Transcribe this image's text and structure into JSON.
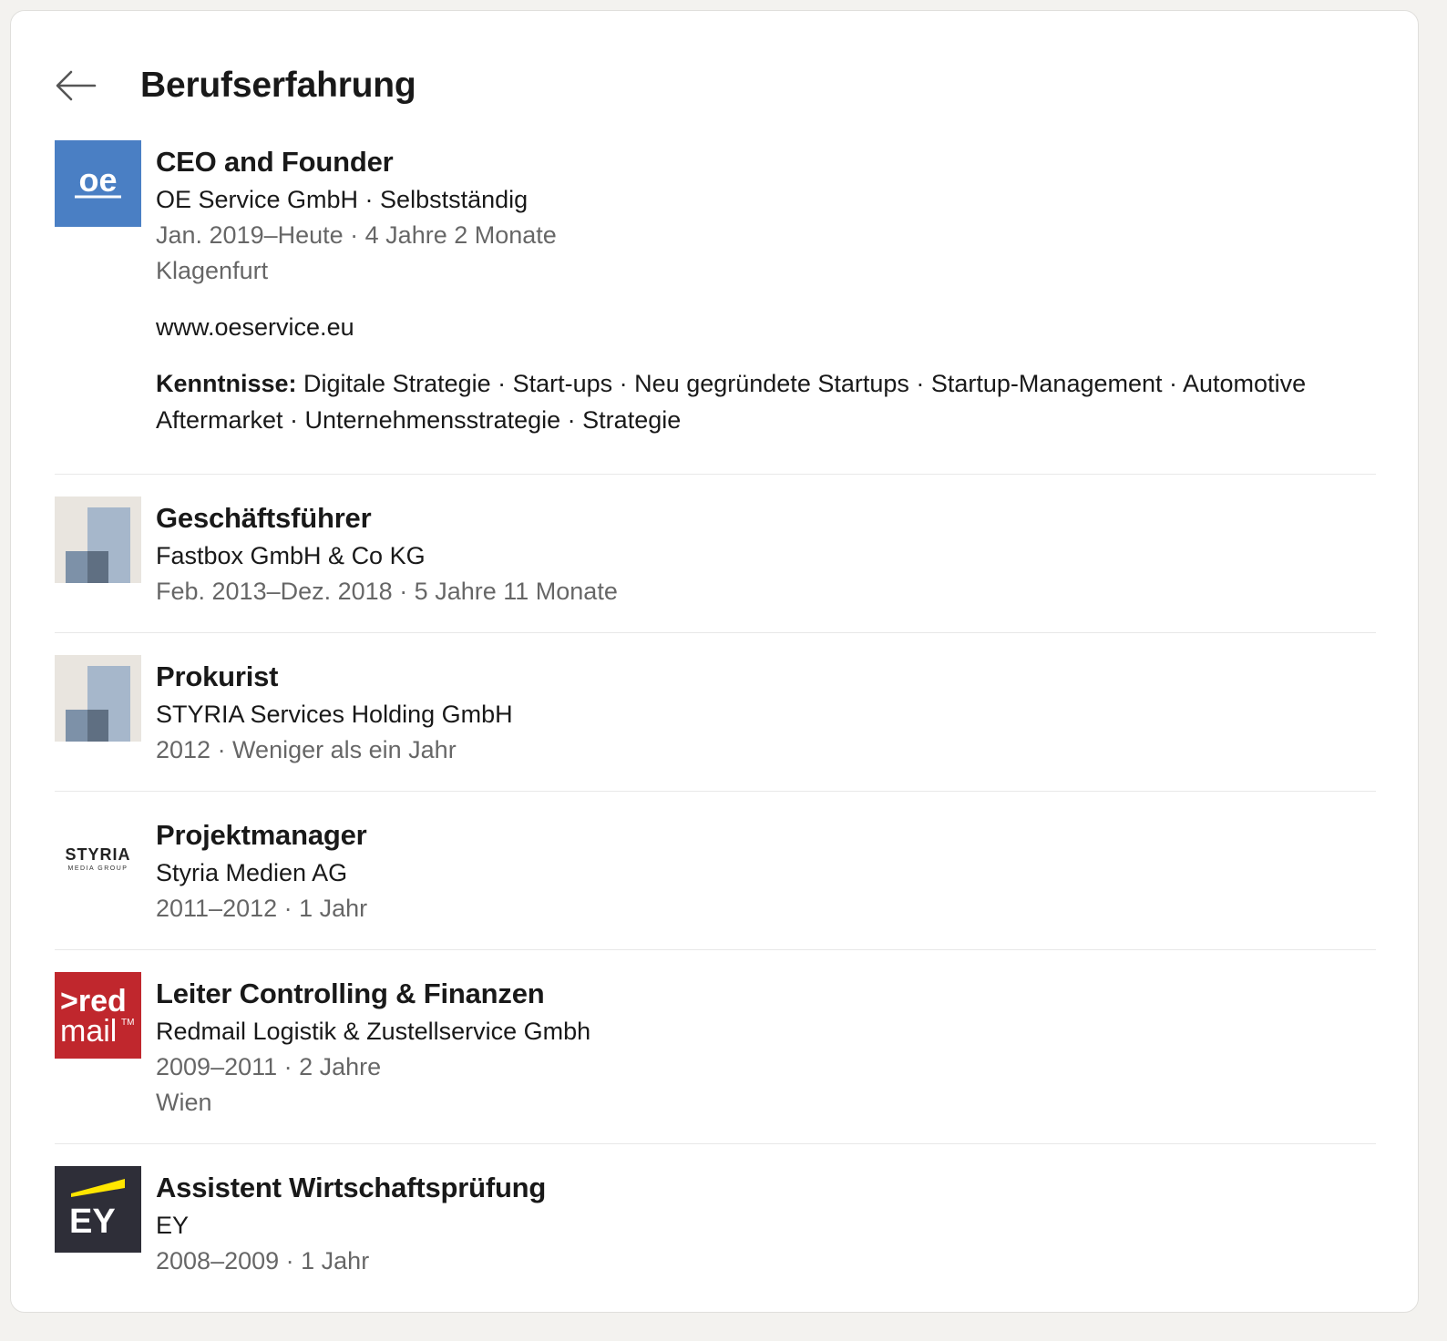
{
  "header": {
    "back_icon": "arrow-left-icon",
    "title": "Berufserfahrung"
  },
  "experiences": [
    {
      "logo": "oe-service-logo",
      "logo_text": "oe",
      "role": "CEO and Founder",
      "company": "OE Service GmbH · Selbstständig",
      "dates": "Jan. 2019–Heute · 4 Jahre 2 Monate",
      "location": "Klagenfurt",
      "description": "www.oeservice.eu",
      "skills_label": "Kenntnisse:",
      "skills": " Digitale Strategie · Start-ups · Neu gegründete Startups · Startup-Management · Automotive Aftermarket · Unternehmensstrategie · Strategie"
    },
    {
      "logo": "placeholder-company-logo",
      "role": "Geschäftsführer",
      "company": "Fastbox GmbH & Co KG",
      "dates": "Feb. 2013–Dez. 2018 · 5 Jahre 11 Monate"
    },
    {
      "logo": "placeholder-company-logo",
      "role": "Prokurist",
      "company": "STYRIA Services Holding GmbH",
      "dates": "2012 · Weniger als ein Jahr"
    },
    {
      "logo": "styria-media-group-logo",
      "logo_text": "STYRIA",
      "logo_subtext": "MEDIA GROUP",
      "role": "Projektmanager",
      "company": "Styria Medien AG",
      "dates": "2011–2012 · 1 Jahr"
    },
    {
      "logo": "redmail-logo",
      "logo_text": ">red",
      "logo_subtext": "mail",
      "role": "Leiter Controlling & Finanzen",
      "company": "Redmail Logistik & Zustellservice Gmbh",
      "dates": "2009–2011 · 2 Jahre",
      "location": "Wien"
    },
    {
      "logo": "ey-logo",
      "logo_text": "EY",
      "role": "Assistent Wirtschaftsprüfung",
      "company": "EY",
      "dates": "2008–2009 · 1 Jahr"
    }
  ],
  "colors": {
    "oe_blue": "#4a7fc4",
    "redmail_red": "#c0272d",
    "ey_dark": "#2e2e38",
    "ey_yellow": "#ffe600"
  }
}
